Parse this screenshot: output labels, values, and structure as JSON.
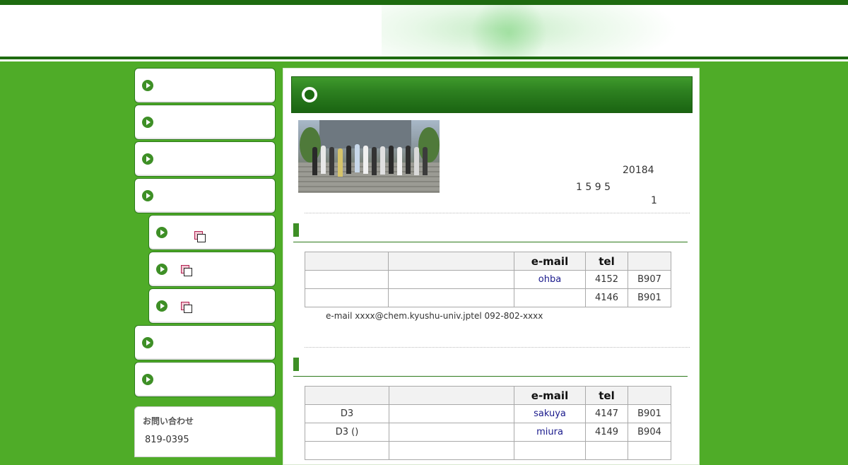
{
  "sidebar": {
    "items": [
      {
        "label": "",
        "external": false
      },
      {
        "label": "",
        "external": false
      },
      {
        "label": "",
        "external": false
      },
      {
        "label": "",
        "external": false
      },
      {
        "label": "",
        "external": true
      },
      {
        "label": "",
        "external": true
      },
      {
        "label": "",
        "external": true
      },
      {
        "label": "",
        "external": false
      },
      {
        "label": "",
        "external": false
      }
    ],
    "contact": {
      "title": "お問い合わせ",
      "zip": "819-0395"
    }
  },
  "main": {
    "title": "",
    "info": {
      "year_month": "20184",
      "count": "1 5 9 5",
      "extra": "1"
    },
    "sections": [
      {
        "heading": "",
        "columns": [
          "",
          "",
          "e-mail",
          "tel",
          ""
        ],
        "rows": [
          [
            "",
            "",
            "ohba",
            "4152",
            "B907"
          ],
          [
            "",
            "",
            "",
            "4146",
            "B901"
          ]
        ],
        "note": "e-mail xxxx@chem.kyushu-univ.jptel 092-802-xxxx"
      },
      {
        "heading": "",
        "columns": [
          "",
          "",
          "e-mail",
          "tel",
          ""
        ],
        "rows": [
          [
            "D3",
            "",
            "sakuya",
            "4147",
            "B901"
          ],
          [
            "D3 ()",
            "",
            "miura",
            "4149",
            "B904"
          ],
          [
            "",
            "",
            "",
            "",
            ""
          ]
        ]
      }
    ]
  },
  "icons": {
    "nav_bullet": "play-circle-icon",
    "external_link": "external-window-icon",
    "title_bullet": "circle-icon"
  },
  "colors": {
    "page_background": "#4fac28",
    "header_dark_green": "#1e6b10",
    "nav_bullet": "#3e8f26",
    "link": "#1a1a8c"
  }
}
